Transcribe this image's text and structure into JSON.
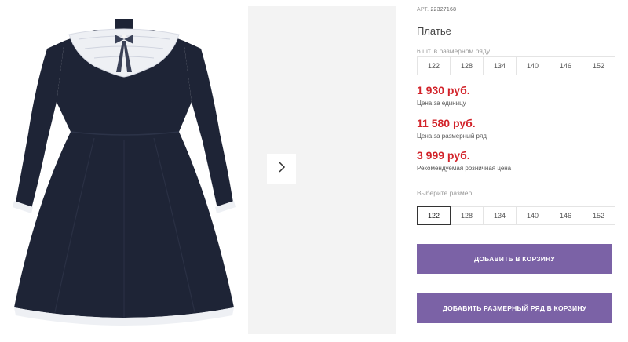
{
  "product": {
    "art_label": "АРТ.",
    "art_number": "22327168",
    "title": "Платье",
    "pack_note": "6 шт. в размерном ряду",
    "pack_sizes": [
      "122",
      "128",
      "134",
      "140",
      "146",
      "152"
    ],
    "prices": {
      "unit_price": "1 930 руб.",
      "unit_label": "Цена за единицу",
      "pack_price": "11 580 руб.",
      "pack_label": "Цена за размерный ряд",
      "retail_price": "3 999 руб.",
      "retail_label": "Рекомендуемая розничная цена"
    },
    "choose_size_label": "Выберите размер:",
    "sizes": [
      "122",
      "128",
      "134",
      "140",
      "146",
      "152"
    ],
    "selected_size": "122"
  },
  "buttons": {
    "add_to_cart": "ДОБАВИТЬ В КОРЗИНУ",
    "add_pack_to_cart": "ДОБАВИТЬ РАЗМЕРНЫЙ РЯД В КОРЗИНУ"
  },
  "colors": {
    "accent": "#7b62a6",
    "price": "#d2232a",
    "dress": "#1e2436",
    "lace": "#f2f2f4"
  },
  "icons": {
    "next": "chevron-right-icon"
  }
}
